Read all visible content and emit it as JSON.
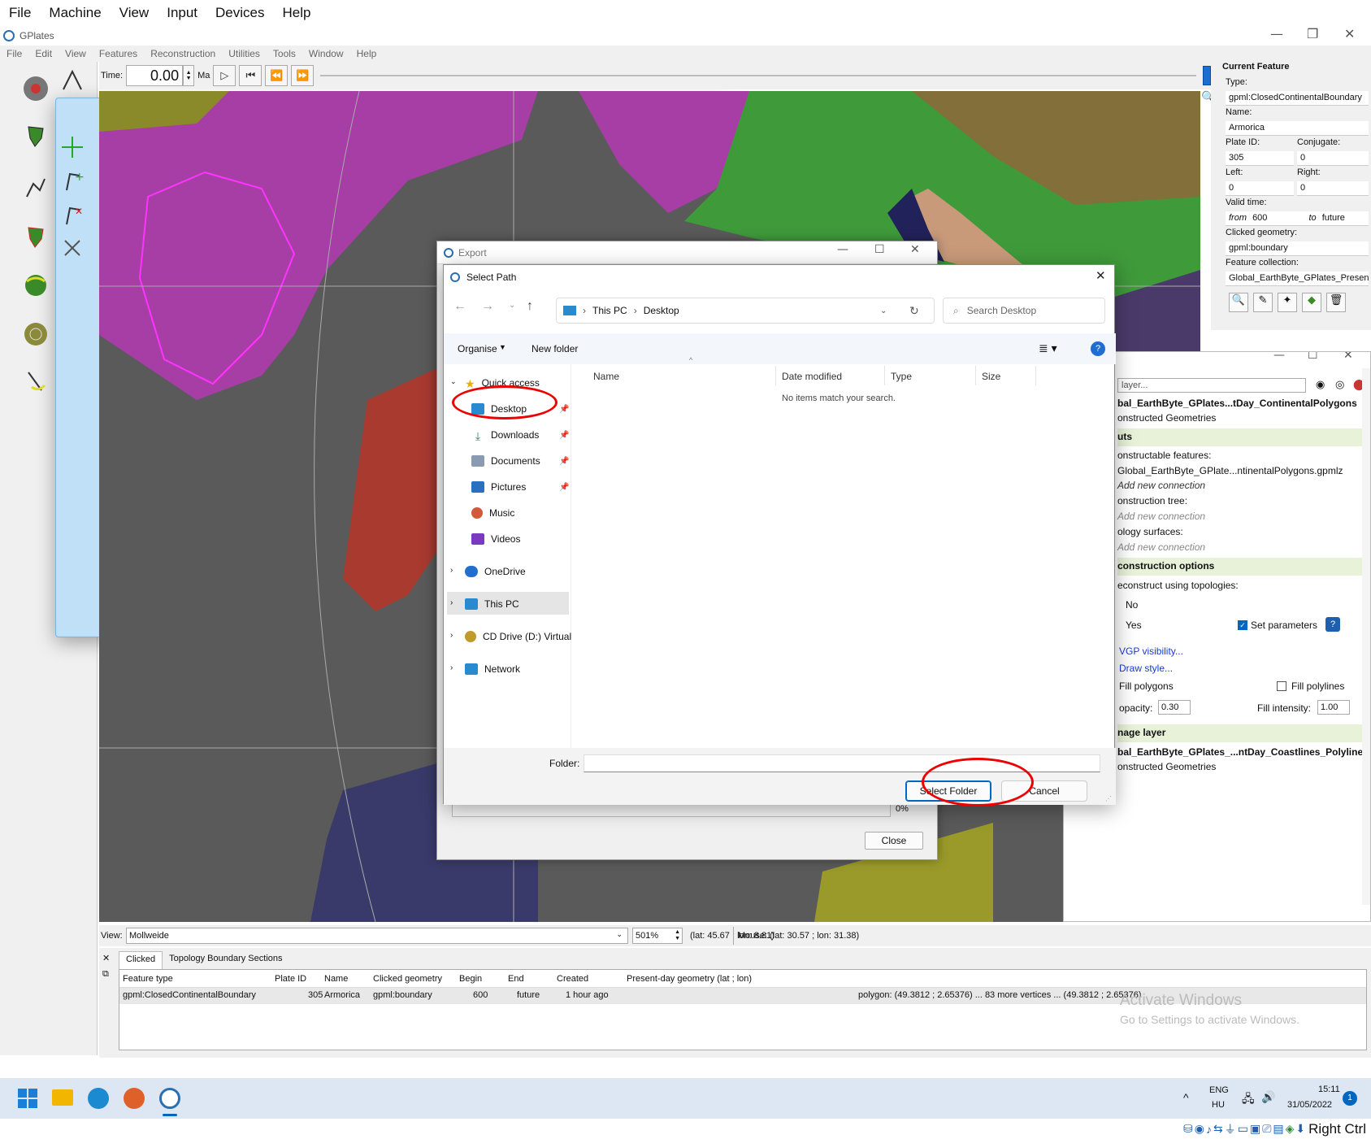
{
  "host_menu": [
    "File",
    "Machine",
    "View",
    "Input",
    "Devices",
    "Help"
  ],
  "app": {
    "title": "GPlates",
    "menu": [
      "File",
      "Edit",
      "View",
      "Features",
      "Reconstruction",
      "Utilities",
      "Tools",
      "Window",
      "Help"
    ]
  },
  "timebar": {
    "label": "Time:",
    "value": "0.00",
    "unit": "Ma"
  },
  "current_feature": {
    "title": "Current Feature",
    "type_label": "Type:",
    "type": "gpml:ClosedContinentalBoundary",
    "name_label": "Name:",
    "name": "Armorica",
    "plate_id_label": "Plate ID:",
    "plate_id": "305",
    "conjugate_label": "Conjugate:",
    "conjugate": "0",
    "left_label": "Left:",
    "left": "0",
    "right_label": "Right:",
    "right": "0",
    "valid_time_label": "Valid time:",
    "from_label": "from",
    "from": "600",
    "to_label": "to",
    "to": "future",
    "clicked_geometry_label": "Clicked geometry:",
    "clicked_geometry": "gpml:boundary",
    "feature_collection_label": "Feature collection:",
    "feature_collection": "Global_EarthByte_GPlates_PresentD"
  },
  "layers": {
    "search_placeholder": "layer...",
    "layer1_name": "bal_EarthByte_GPlates...tDay_ContinentalPolygons",
    "layer1_sub": "onstructed Geometries",
    "inputs_header": "uts",
    "reconstructable_label": "onstructable features:",
    "reconstructable_file": "Global_EarthByte_GPlate...ntinentalPolygons.gpmlz",
    "add_conn1": "Add new connection",
    "reconstruction_tree_label": "onstruction tree:",
    "add_conn2": "Add new connection",
    "topology_label": "ology surfaces:",
    "add_conn3": "Add new connection",
    "options_header": "construction options",
    "topologies_label": "econstruct using topologies:",
    "no": "No",
    "yes": "Yes",
    "set_params": "Set parameters",
    "vgp": "VGP visibility...",
    "draw_style": "Draw style...",
    "fill_polygons": "Fill polygons",
    "fill_polylines": "Fill polylines",
    "opacity_label": "opacity:",
    "opacity": "0.30",
    "fill_intensity_label": "Fill intensity:",
    "fill_intensity": "1.00",
    "image_header": "nage layer",
    "layer2_name": "bal_EarthByte_GPlates_...ntDay_Coastlines_Polyline",
    "layer2_sub": "onstructed Geometries"
  },
  "export_dialog": {
    "title": "Export",
    "progress": "0%",
    "close": "Close"
  },
  "select_path": {
    "title": "Select Path",
    "crumbs": [
      "This PC",
      "Desktop"
    ],
    "search_placeholder": "Search Desktop",
    "organise": "Organise",
    "new_folder": "New folder",
    "columns": [
      "Name",
      "Date modified",
      "Type",
      "Size"
    ],
    "empty": "No items match your search.",
    "nav": {
      "quick_access": "Quick access",
      "desktop": "Desktop",
      "downloads": "Downloads",
      "documents": "Documents",
      "pictures": "Pictures",
      "music": "Music",
      "videos": "Videos",
      "onedrive": "OneDrive",
      "this_pc": "This PC",
      "cd_drive": "CD Drive (D:) Virtual",
      "network": "Network"
    },
    "folder_label": "Folder:",
    "folder_value": "",
    "select_folder": "Select Folder",
    "cancel": "Cancel"
  },
  "status": {
    "view_label": "View:",
    "projection": "Mollweide",
    "zoom": "501%",
    "latlon": "(lat: 45.67 ; lon: 8.81)",
    "mouse": "Mouse: (lat: 30.57 ; lon: 31.38)"
  },
  "bottom": {
    "tabs": [
      "Clicked",
      "Topology Boundary Sections"
    ],
    "columns": [
      "Feature type",
      "Plate ID",
      "Name",
      "Clicked geometry",
      "Begin",
      "End",
      "Created",
      "Present-day geometry (lat ; lon)"
    ],
    "row": [
      "gpml:ClosedContinentalBoundary",
      "305",
      "Armorica",
      "gpml:boundary",
      "600",
      "future",
      "1 hour ago",
      "polygon: (49.3812 ; 2.65376) ... 83 more vertices ... (49.3812 ; 2.65376)"
    ]
  },
  "watermark": {
    "line1": "Activate Windows",
    "line2": "Go to Settings to activate Windows."
  },
  "taskbar": {
    "lang1": "ENG",
    "lang2": "HU",
    "time": "15:11",
    "date": "31/05/2022",
    "badge": "1"
  },
  "host_status": {
    "right_ctrl": "Right Ctrl"
  },
  "colors": {
    "magenta": "#b03ab0",
    "green": "#3f9a3a",
    "red": "#b43a2e",
    "olive": "#9a9a2a",
    "navy": "#4a4a7a",
    "purple": "#5a3a6a",
    "accent": "#0067c0",
    "ring": "#e00000"
  }
}
